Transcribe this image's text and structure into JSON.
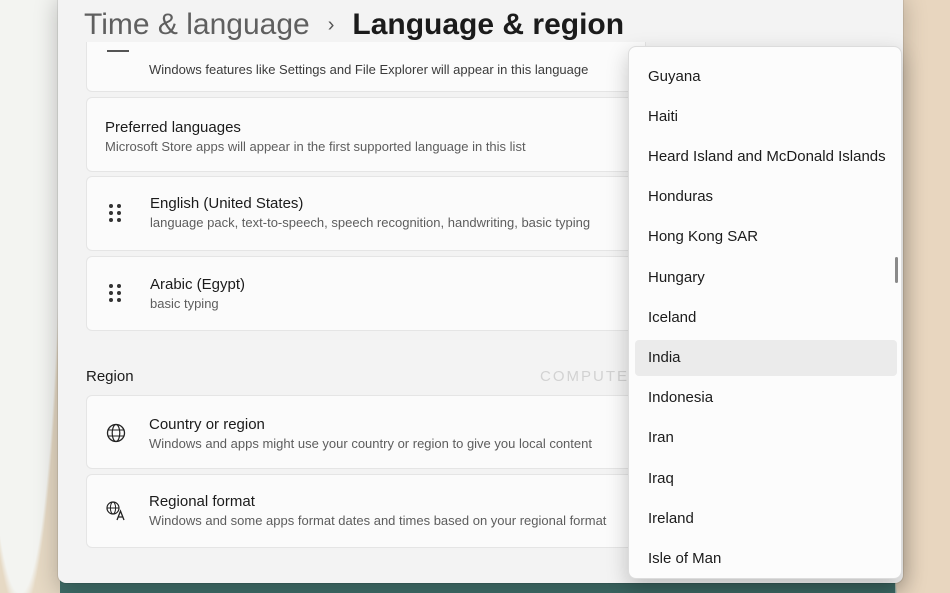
{
  "breadcrumb": {
    "parent": "Time & language",
    "separator": "›",
    "current": "Language & region"
  },
  "display_language": {
    "subtitle": "Windows features like Settings and File Explorer will appear in this language"
  },
  "preferred_languages": {
    "title": "Preferred languages",
    "subtitle": "Microsoft Store apps will appear in the first supported language in this list"
  },
  "languages": [
    {
      "name": "English (United States)",
      "features": "language pack, text-to-speech, speech recognition, handwriting, basic typing"
    },
    {
      "name": "Arabic (Egypt)",
      "features": "basic typing"
    }
  ],
  "region": {
    "section_label": "Region",
    "country": {
      "title": "Country or region",
      "subtitle": "Windows and apps might use your country or region to give you local content",
      "icon": "globe-icon"
    },
    "format": {
      "title": "Regional format",
      "subtitle": "Windows and some apps format dates and times based on your regional format",
      "icon": "regional-format-icon"
    }
  },
  "country_dropdown": {
    "selected": "India",
    "items": [
      "Guyana",
      "Haiti",
      "Heard Island and McDonald Islands",
      "Honduras",
      "Hong Kong SAR",
      "Hungary",
      "Iceland",
      "India",
      "Indonesia",
      "Iran",
      "Iraq",
      "Ireland",
      "Isle of Man"
    ]
  },
  "watermark": "COMPUTERWD.COM",
  "colors": {
    "selected_item_bg": "#ebebeb",
    "window_bg": "#f3f3f3"
  }
}
